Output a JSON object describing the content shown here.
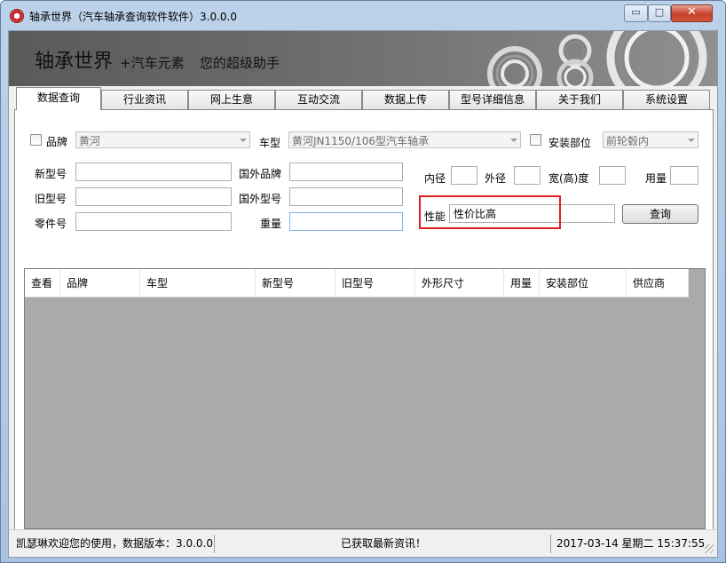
{
  "window": {
    "title": "轴承世界（汽车轴承查询软件软件）3.0.0.0",
    "buttons": {
      "minimize": "▭",
      "maximize": "□",
      "close": "✕"
    }
  },
  "banner": {
    "title": "轴承世界",
    "subtitle": "+汽车元素",
    "slogan": "您的超级助手"
  },
  "tabs": [
    {
      "label": "数据查询",
      "active": true
    },
    {
      "label": "行业资讯"
    },
    {
      "label": "网上生意"
    },
    {
      "label": "互动交流"
    },
    {
      "label": "数据上传"
    },
    {
      "label": "型号详细信息"
    },
    {
      "label": "关于我们"
    },
    {
      "label": "系统设置"
    }
  ],
  "filters": {
    "brand": {
      "label": "品牌",
      "value": "黄河",
      "checked": false
    },
    "vehicle": {
      "label": "车型",
      "value": "黄河JN1150/106型汽车轴承"
    },
    "install": {
      "label": "安装部位",
      "value": "前轮毂内",
      "checked": false
    }
  },
  "fields": {
    "new_model": {
      "label": "新型号",
      "value": ""
    },
    "old_model": {
      "label": "旧型号",
      "value": ""
    },
    "part_no": {
      "label": "零件号",
      "value": ""
    },
    "foreign_brand": {
      "label": "国外品牌",
      "value": ""
    },
    "foreign_model": {
      "label": "国外型号",
      "value": ""
    },
    "weight": {
      "label": "重量",
      "value": ""
    },
    "inner_dia": {
      "label": "内径",
      "value": ""
    },
    "outer_dia": {
      "label": "外径",
      "value": ""
    },
    "width": {
      "label": "宽(高)度",
      "value": ""
    },
    "quantity": {
      "label": "用量",
      "value": ""
    },
    "performance": {
      "label": "性能",
      "value": "性价比高"
    }
  },
  "query_button": "查询",
  "table": {
    "columns": [
      "查看",
      "品牌",
      "车型",
      "新型号",
      "旧型号",
      "外形尺寸",
      "用量",
      "安装部位",
      "供应商"
    ],
    "rows": []
  },
  "status": {
    "welcome": "凯瑟琳欢迎您的使用，数据版本：3.0.0.0",
    "message": "已获取最新资讯！",
    "datetime": "2017-03-14 星期二 15:37:55"
  },
  "colors": {
    "highlight": "#e02020",
    "grid_bg": "#aaaaaa",
    "banner": "#6b6b6b"
  }
}
